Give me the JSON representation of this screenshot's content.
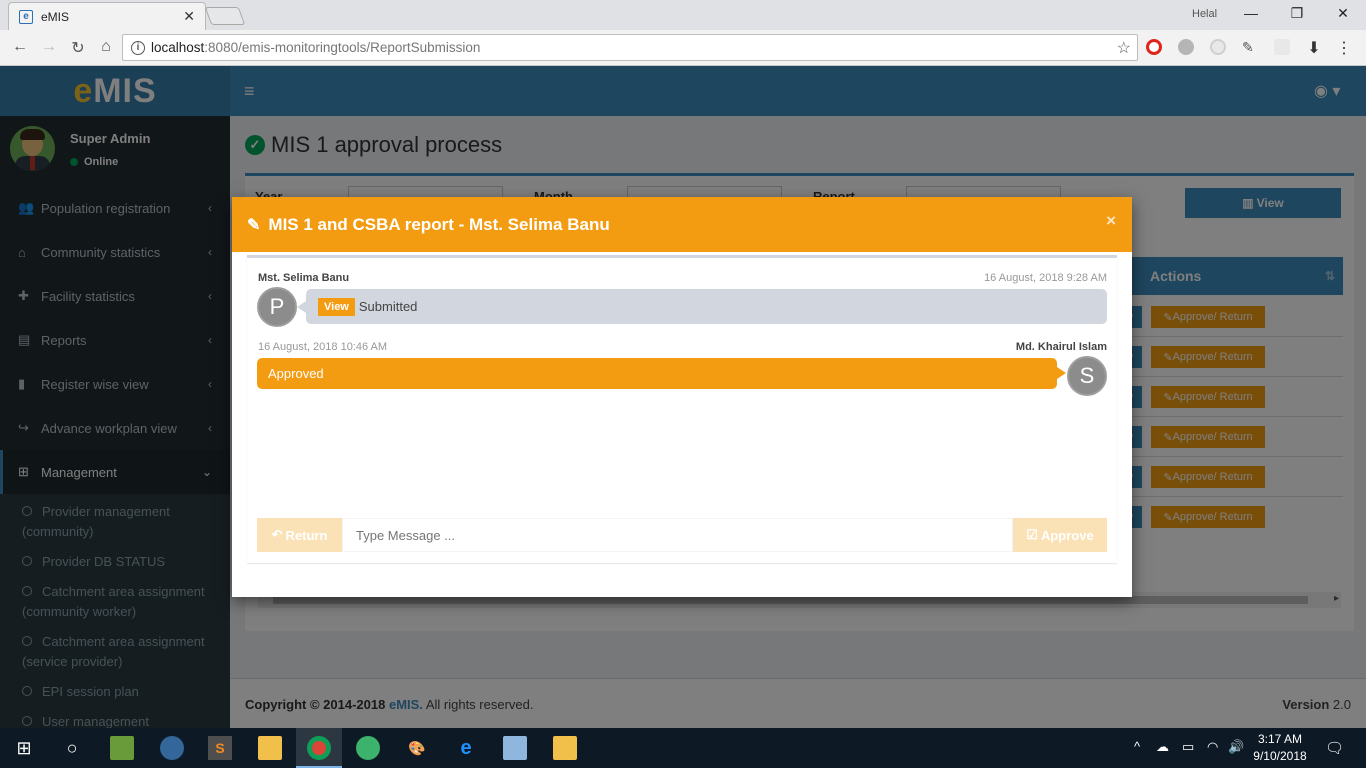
{
  "browser": {
    "tab_title": "eMIS",
    "tab_close": "✕",
    "window_user": "Helal",
    "url_host": "localhost",
    "url_rest": ":8080/emis-monitoringtools/ReportSubmission"
  },
  "app": {
    "logo_e": "e",
    "logo_rest": "MIS"
  },
  "user": {
    "name": "Super Admin",
    "status": "Online"
  },
  "sidebar": {
    "items": [
      {
        "label": "Population registration",
        "icon": "users-icon"
      },
      {
        "label": "Community statistics",
        "icon": "home-icon"
      },
      {
        "label": "Facility statistics",
        "icon": "medkit-icon"
      },
      {
        "label": "Reports",
        "icon": "list-alt-icon"
      },
      {
        "label": "Register wise view",
        "icon": "book-icon"
      },
      {
        "label": "Advance workplan view",
        "icon": "share-icon"
      },
      {
        "label": "Management",
        "icon": "sitemap-icon"
      }
    ],
    "subitems": [
      "Provider management (community)",
      "Provider DB STATUS",
      "Catchment area assignment (community worker)",
      "Catchment area assignment (service provider)",
      "EPI session plan",
      "User management"
    ]
  },
  "page": {
    "title": "MIS 1 approval process",
    "filters": {
      "year_label": "Year",
      "month_label": "Month",
      "report_label": "Report"
    },
    "view_button": "View",
    "actions_header": "Actions",
    "row_view": "w",
    "row_approve": "Approve/ Return",
    "rows_count_label": ""
  },
  "footer": {
    "copyright_prefix": "Copyright © 2014-2018 ",
    "brand": "eMIS.",
    "copyright_suffix": " All rights reserved.",
    "version_label": "Version",
    "version_value": "2.0"
  },
  "modal": {
    "title": "MIS 1 and CSBA report - Mst. Selima Banu",
    "close": "×",
    "message1": {
      "name": "Mst. Selima Banu",
      "time": "16 August, 2018 9:28 AM",
      "avatar": "P",
      "tag": "View",
      "text": "Submitted"
    },
    "message2": {
      "name": "Md. Khairul Islam",
      "time": "16 August, 2018 10:46 AM",
      "avatar": "S",
      "text": "Approved"
    },
    "return_button": "Return",
    "input_placeholder": "Type Message ...",
    "approve_button": "Approve"
  },
  "taskbar": {
    "time": "3:17 AM",
    "date": "9/10/2018"
  },
  "colors": {
    "primary": "#3c8dbc",
    "warning": "#f39c12",
    "success": "#00a65a",
    "sidebar": "#222d32"
  }
}
